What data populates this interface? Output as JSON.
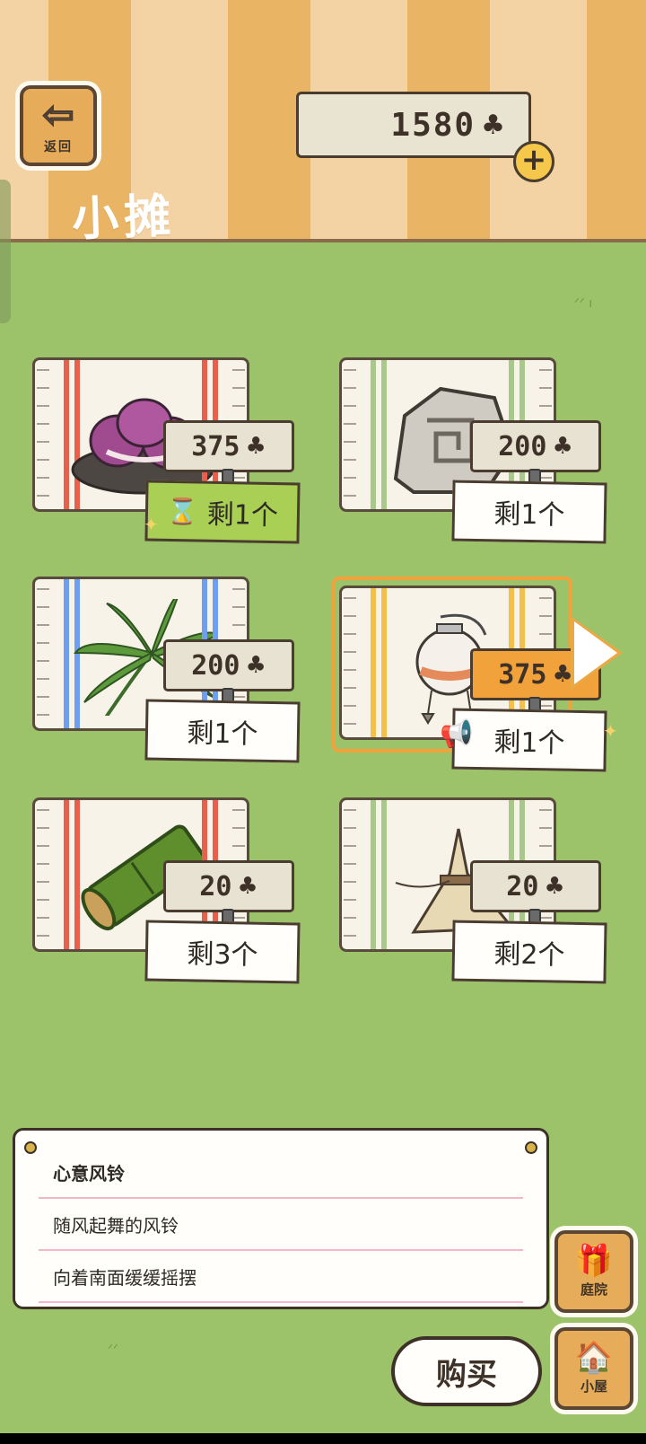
{
  "header": {
    "back_label": "返回",
    "title": "小摊",
    "currency_amount": "1580"
  },
  "items": [
    {
      "name": "purple-mochi",
      "price": "375",
      "stock": "剩1个",
      "stock_style": "timed",
      "stripe_color": "#e8604b",
      "selected": false
    },
    {
      "name": "stone",
      "price": "200",
      "stock": "剩1个",
      "stock_style": "normal",
      "stripe_color": "#a9c98a",
      "selected": false
    },
    {
      "name": "palm-leaf",
      "price": "200",
      "stock": "剩1个",
      "stock_style": "normal",
      "stripe_color": "#6e9ef0",
      "selected": false
    },
    {
      "name": "wind-chime",
      "price": "375",
      "stock": "剩1个",
      "stock_style": "normal",
      "stripe_color": "#f3c04a",
      "selected": true
    },
    {
      "name": "bamboo",
      "price": "20",
      "stock": "剩3个",
      "stock_style": "normal",
      "stripe_color": "#e8604b",
      "selected": false
    },
    {
      "name": "straw-bundle",
      "price": "20",
      "stock": "剩2个",
      "stock_style": "normal",
      "stripe_color": "#a9c98a",
      "selected": false
    }
  ],
  "description": {
    "name": "心意风铃",
    "line1": "随风起舞的风铃",
    "line2": "向着南面缓缓摇摆"
  },
  "side_buttons": {
    "yard_label": "庭院",
    "house_label": "小屋"
  },
  "buy_label": "购买",
  "icons": {
    "currency": "clover-icon",
    "back": "arrow-left-icon",
    "yard": "gift-icon",
    "house": "house-icon"
  }
}
